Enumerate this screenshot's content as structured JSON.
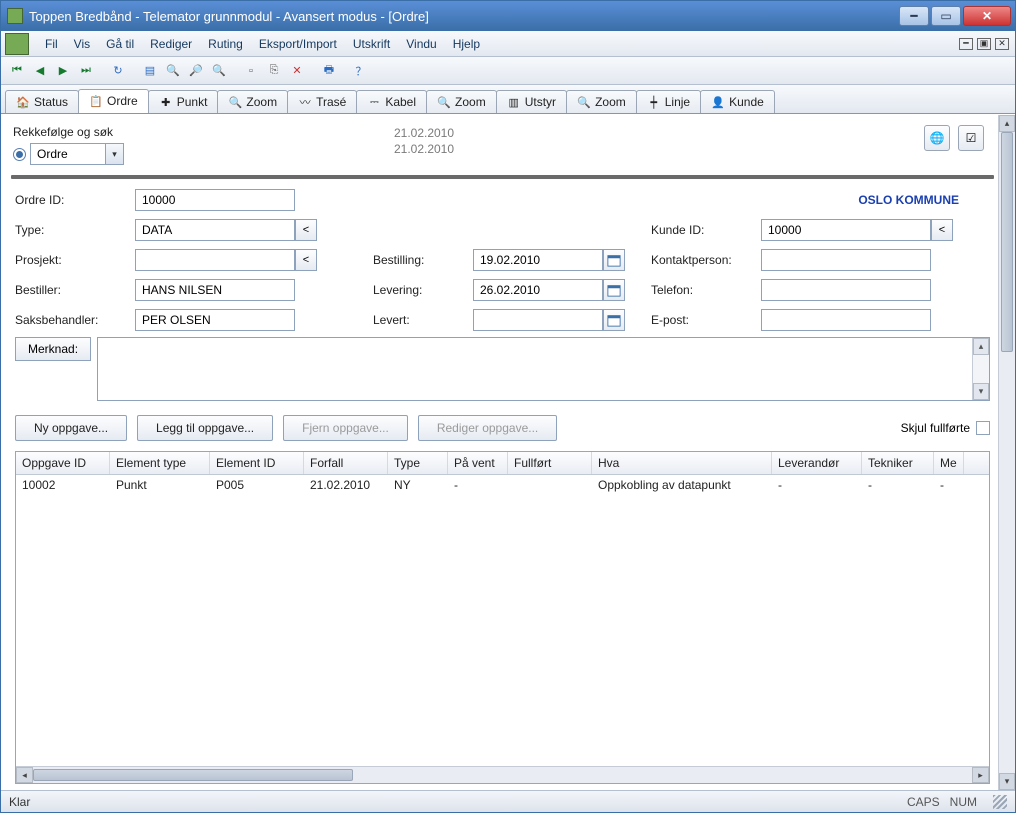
{
  "title": "Toppen Bredbånd - Telemator grunnmodul - Avansert modus - [Ordre]",
  "menu": [
    "Fil",
    "Vis",
    "Gå til",
    "Rediger",
    "Ruting",
    "Eksport/Import",
    "Utskrift",
    "Vindu",
    "Hjelp"
  ],
  "tabs": [
    {
      "label": "Status",
      "icon": "🏠"
    },
    {
      "label": "Ordre",
      "icon": "📋",
      "active": true
    },
    {
      "label": "Punkt",
      "icon": "✚"
    },
    {
      "label": "Zoom",
      "icon": "🔍"
    },
    {
      "label": "Trasé",
      "icon": "〰"
    },
    {
      "label": "Kabel",
      "icon": "⎓"
    },
    {
      "label": "Zoom",
      "icon": "🔍"
    },
    {
      "label": "Utstyr",
      "icon": "▥"
    },
    {
      "label": "Zoom",
      "icon": "🔍"
    },
    {
      "label": "Linje",
      "icon": "┿"
    },
    {
      "label": "Kunde",
      "icon": "👤"
    }
  ],
  "sort": {
    "label": "Rekkefølge og søk",
    "selected": "Ordre"
  },
  "top_dates": [
    "21.02.2010",
    "21.02.2010"
  ],
  "company": "OSLO KOMMUNE",
  "form": {
    "ordreid_label": "Ordre ID:",
    "ordreid": "10000",
    "type_label": "Type:",
    "type": "DATA",
    "prosjekt_label": "Prosjekt:",
    "prosjekt": "",
    "bestiller_label": "Bestiller:",
    "bestiller": "HANS NILSEN",
    "saksbehandler_label": "Saksbehandler:",
    "saksbehandler": "PER OLSEN",
    "bestilling_label": "Bestilling:",
    "bestilling": "19.02.2010",
    "levering_label": "Levering:",
    "levering": "26.02.2010",
    "levert_label": "Levert:",
    "levert": "",
    "kundeid_label": "Kunde ID:",
    "kundeid": "10000",
    "kontakt_label": "Kontaktperson:",
    "kontakt": "",
    "telefon_label": "Telefon:",
    "telefon": "",
    "epost_label": "E-post:",
    "epost": ""
  },
  "merknad_label": "Merknad:",
  "buttons": {
    "ny": "Ny oppgave...",
    "legg": "Legg til oppgave...",
    "fjern": "Fjern oppgave...",
    "rediger": "Rediger oppgave...",
    "skjul": "Skjul fullførte"
  },
  "table": {
    "headers": [
      "Oppgave ID",
      "Element type",
      "Element ID",
      "Forfall",
      "Type",
      "På vent",
      "Fullført",
      "Hva",
      "Leverandør",
      "Tekniker",
      "Me"
    ],
    "rows": [
      {
        "oppgaveid": "10002",
        "eltype": "Punkt",
        "elid": "P005",
        "forfall": "21.02.2010",
        "type": "NY",
        "pavent": "-",
        "fullfort": "",
        "hva": "Oppkobling av datapunkt",
        "lev": "-",
        "tek": "-",
        "me": "-"
      }
    ]
  },
  "status": {
    "left": "Klar",
    "caps": "CAPS",
    "num": "NUM"
  }
}
